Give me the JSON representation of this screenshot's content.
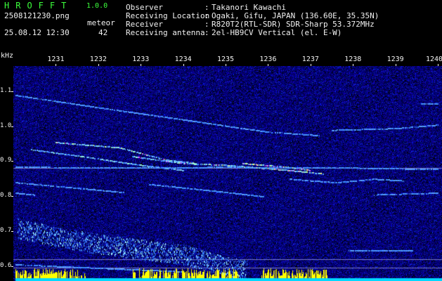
{
  "header": {
    "logo": "HROFFT",
    "version": "1.0.0",
    "filename": "2508121230.png",
    "datetime": "25.08.12 12:30",
    "meteor_label": "meteor",
    "meteor_count": "42",
    "info": [
      {
        "key": "Observer",
        "value": "Takanori Kawachi"
      },
      {
        "key": "Receiving Location",
        "value": "Ogaki, Gifu, JAPAN (136.60E, 35.35N)"
      },
      {
        "key": "Receiver",
        "value": "R820T2(RTL-SDR) SDR-Sharp 53.372MHz"
      },
      {
        "key": "Receiving antenna",
        "value": "2el-HB9CV Vertical (el. E-W)"
      }
    ],
    "separator": ":"
  },
  "axes": {
    "unit": "kHz",
    "x_ticks": [
      "1231",
      "1232",
      "1233",
      "1234",
      "1235",
      "1236",
      "1237",
      "1238",
      "1239",
      "1240"
    ],
    "y_ticks": [
      "1.1",
      "1.0",
      "0.9",
      "0.8",
      "0.7",
      "0.6"
    ]
  },
  "colors": {
    "header_green": "#3cff3c",
    "text_white": "#f2f2f2",
    "background": "#000000",
    "noise_floor": "#06065a",
    "trace": "#3a8cff",
    "meteor_hot": "#ff40ff",
    "level_bar": "#ffff00"
  },
  "chart_data": {
    "type": "heatmap",
    "xlabel": "",
    "ylabel": "kHz",
    "x_range": [
      1230.0,
      1240.0
    ],
    "y_range": [
      0.56,
      1.19
    ],
    "x_ticks": [
      1231,
      1232,
      1233,
      1234,
      1235,
      1236,
      1237,
      1238,
      1239,
      1240
    ],
    "y_ticks": [
      1.1,
      1.0,
      0.9,
      0.8,
      0.7,
      0.6
    ],
    "reference_lines": [
      0.88,
      0.62,
      0.595
    ],
    "traces": [
      {
        "points": [
          [
            1230.05,
            1.09
          ],
          [
            1232.0,
            1.055
          ],
          [
            1234.0,
            1.02
          ],
          [
            1236.0,
            0.985
          ],
          [
            1237.2,
            0.975
          ]
        ],
        "intensity": 0.6
      },
      {
        "points": [
          [
            1237.5,
            0.99
          ],
          [
            1239.0,
            0.995
          ],
          [
            1240.0,
            1.005
          ]
        ],
        "intensity": 0.5
      },
      {
        "points": [
          [
            1239.6,
            1.065
          ],
          [
            1240.0,
            1.065
          ]
        ],
        "intensity": 0.5
      },
      {
        "points": [
          [
            1231.0,
            0.955
          ],
          [
            1232.5,
            0.94
          ],
          [
            1233.6,
            0.905
          ],
          [
            1234.3,
            0.895
          ]
        ],
        "intensity": 0.9
      },
      {
        "points": [
          [
            1230.4,
            0.935
          ],
          [
            1231.6,
            0.915
          ],
          [
            1233.0,
            0.89
          ],
          [
            1234.0,
            0.875
          ]
        ],
        "intensity": 0.85
      },
      {
        "points": [
          [
            1232.8,
            0.915
          ],
          [
            1234.0,
            0.895
          ],
          [
            1235.0,
            0.89
          ],
          [
            1236.5,
            0.875
          ],
          [
            1237.3,
            0.865
          ]
        ],
        "intensity": 0.95
      },
      {
        "points": [
          [
            1235.4,
            0.895
          ],
          [
            1236.4,
            0.885
          ],
          [
            1237.0,
            0.875
          ]
        ],
        "intensity": 1.0
      },
      {
        "points": [
          [
            1230.05,
            0.885
          ],
          [
            1232.0,
            0.882
          ],
          [
            1235.0,
            0.884
          ],
          [
            1238.0,
            0.882
          ],
          [
            1240.0,
            0.878
          ]
        ],
        "intensity": 0.55
      },
      {
        "points": [
          [
            1230.05,
            0.84
          ],
          [
            1231.4,
            0.825
          ],
          [
            1232.6,
            0.812
          ]
        ],
        "intensity": 0.6
      },
      {
        "points": [
          [
            1233.2,
            0.835
          ],
          [
            1234.8,
            0.815
          ],
          [
            1235.9,
            0.8
          ]
        ],
        "intensity": 0.6
      },
      {
        "points": [
          [
            1236.5,
            0.85
          ],
          [
            1237.6,
            0.84
          ],
          [
            1238.5,
            0.85
          ],
          [
            1239.2,
            0.845
          ]
        ],
        "intensity": 0.55
      },
      {
        "points": [
          [
            1230.05,
            0.81
          ],
          [
            1230.5,
            0.805
          ]
        ],
        "intensity": 0.5
      },
      {
        "points": [
          [
            1238.5,
            0.805
          ],
          [
            1240.0,
            0.81
          ]
        ],
        "intensity": 0.5
      },
      {
        "points": [
          [
            1237.9,
            0.645
          ],
          [
            1239.4,
            0.645
          ]
        ],
        "intensity": 0.5
      },
      {
        "points": [
          [
            1230.05,
            0.605
          ],
          [
            1232.0,
            0.595
          ],
          [
            1234.0,
            0.585
          ]
        ],
        "intensity": 0.5
      }
    ],
    "dense_band": {
      "points": [
        [
          1230.1,
          0.72
        ],
        [
          1231.0,
          0.695
        ],
        [
          1232.0,
          0.675
        ],
        [
          1233.0,
          0.66
        ],
        [
          1234.0,
          0.645
        ],
        [
          1235.0,
          0.61
        ],
        [
          1235.5,
          0.6
        ]
      ],
      "intensity": 0.75
    },
    "level_bars": {
      "x_start": 1230.05,
      "x_end": 1240.0,
      "hot_spans": [
        [
          1230.0,
          1231.7
        ],
        [
          1232.8,
          1235.3
        ],
        [
          1235.8,
          1237.4
        ]
      ]
    }
  }
}
